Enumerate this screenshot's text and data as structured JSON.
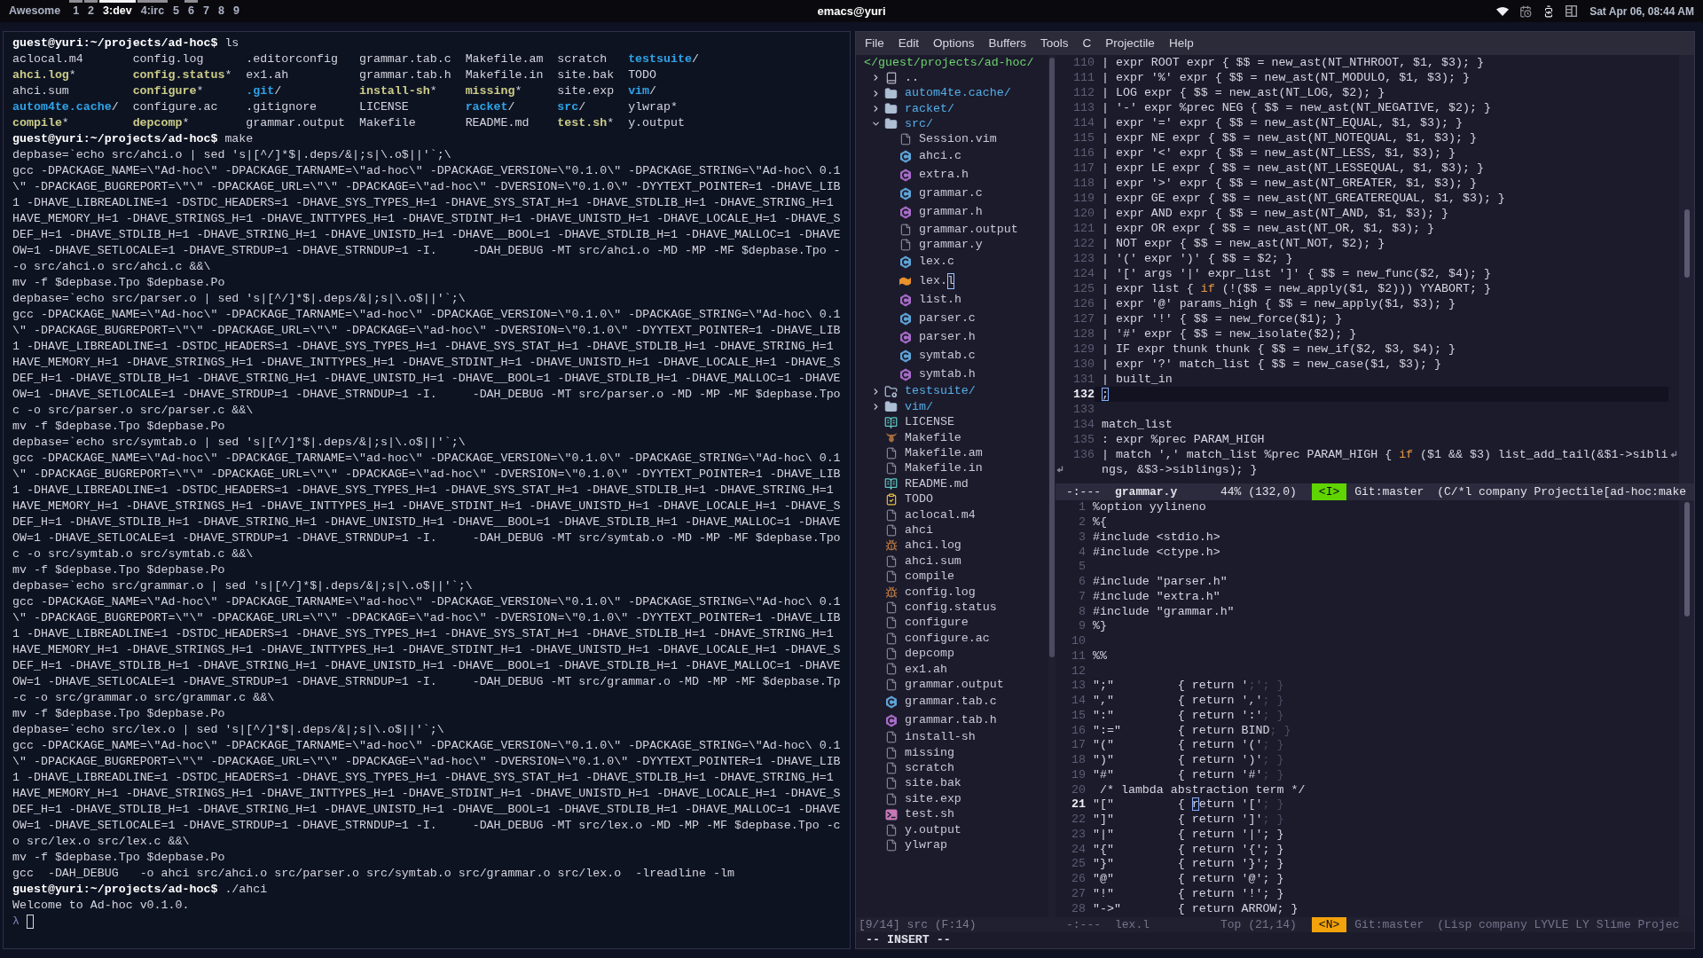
{
  "top_bar": {
    "launcher": "Awesome",
    "tags": [
      {
        "label": "1",
        "selected": false,
        "occupied": true
      },
      {
        "label": "2",
        "selected": false,
        "occupied": true
      },
      {
        "label": "3:dev",
        "selected": true,
        "occupied": true
      },
      {
        "label": "4:irc",
        "selected": false,
        "occupied": true
      },
      {
        "label": "5",
        "selected": false,
        "occupied": false
      },
      {
        "label": "6",
        "selected": false,
        "occupied": true
      },
      {
        "label": "7",
        "selected": false,
        "occupied": false
      },
      {
        "label": "8",
        "selected": false,
        "occupied": false
      },
      {
        "label": "9",
        "selected": false,
        "occupied": false
      }
    ],
    "title": "emacs@yuri",
    "clock": "Sat Apr 06, 08:44 AM"
  },
  "terminal": {
    "lines": [
      {
        "kind": "command",
        "prompt": "guest@yuri:~/projects/ad-hoc$",
        "command": "ls"
      },
      {
        "kind": "listing",
        "entries": [
          {
            "name": "aclocal.m4",
            "kind": "file"
          },
          {
            "name": "config.log",
            "kind": "file"
          },
          {
            "name": ".editorconfig",
            "kind": "file"
          },
          {
            "name": "grammar.tab.c",
            "kind": "file"
          },
          {
            "name": "Makefile.am",
            "kind": "file"
          },
          {
            "name": "scratch",
            "kind": "file"
          },
          {
            "name": "testsuite",
            "suffix": "/",
            "kind": "dir"
          }
        ]
      },
      {
        "kind": "listing",
        "entries": [
          {
            "name": "ahci.log",
            "suffix": "*",
            "kind": "exec"
          },
          {
            "name": "config.status",
            "suffix": "*",
            "kind": "exec"
          },
          {
            "name": "ex1.ah",
            "kind": "file"
          },
          {
            "name": "grammar.tab.h",
            "kind": "file"
          },
          {
            "name": "Makefile.in",
            "kind": "file"
          },
          {
            "name": "site.bak",
            "kind": "file"
          },
          {
            "name": "TODO",
            "kind": "file"
          }
        ]
      },
      {
        "kind": "listing",
        "entries": [
          {
            "name": "ahci.sum",
            "kind": "file"
          },
          {
            "name": "configure",
            "suffix": "*",
            "kind": "exec"
          },
          {
            "name": ".git",
            "suffix": "/",
            "kind": "dir"
          },
          {
            "name": "install-sh",
            "suffix": "*",
            "kind": "exec"
          },
          {
            "name": "missing",
            "suffix": "*",
            "kind": "exec"
          },
          {
            "name": "site.exp",
            "kind": "file"
          },
          {
            "name": "vim",
            "suffix": "/",
            "kind": "dir"
          }
        ]
      },
      {
        "kind": "listing",
        "entries": [
          {
            "name": "autom4te.cache",
            "suffix": "/",
            "kind": "dir"
          },
          {
            "name": "configure.ac",
            "kind": "file"
          },
          {
            "name": ".gitignore",
            "kind": "file"
          },
          {
            "name": "LICENSE",
            "kind": "file"
          },
          {
            "name": "racket",
            "suffix": "/",
            "kind": "dir"
          },
          {
            "name": "src",
            "suffix": "/",
            "kind": "dir"
          },
          {
            "name": "ylwrap",
            "suffix": "*",
            "kind": "file"
          }
        ]
      },
      {
        "kind": "listing",
        "entries": [
          {
            "name": "compile",
            "suffix": "*",
            "kind": "exec"
          },
          {
            "name": "depcomp",
            "suffix": "*",
            "kind": "exec"
          },
          {
            "name": "grammar.output",
            "kind": "file"
          },
          {
            "name": "Makefile",
            "kind": "file"
          },
          {
            "name": "README.md",
            "kind": "file"
          },
          {
            "name": "test.sh",
            "suffix": "*",
            "kind": "exec"
          },
          {
            "name": "y.output",
            "kind": "file"
          }
        ]
      },
      {
        "kind": "command",
        "prompt": "guest@yuri:~/projects/ad-hoc$",
        "command": "make"
      },
      {
        "kind": "output",
        "text": "depbase=`echo src/ahci.o | sed 's|[^/]*$|.deps/&|;s|\\.o$||'`;\\"
      },
      {
        "kind": "output",
        "text": "gcc -DPACKAGE_NAME=\\\"Ad-hoc\\\" -DPACKAGE_TARNAME=\\\"ad-hoc\\\" -DPACKAGE_VERSION=\\\"0.1.0\\\" -DPACKAGE_STRING=\\\"Ad-hoc\\ 0.1"
      },
      {
        "kind": "output",
        "text": "\\\" -DPACKAGE_BUGREPORT=\\\"\\\" -DPACKAGE_URL=\\\"\\\" -DPACKAGE=\\\"ad-hoc\\\" -DVERSION=\\\"0.1.0\\\" -DYYTEXT_POINTER=1 -DHAVE_LIB"
      },
      {
        "kind": "output",
        "text": "1 -DHAVE_LIBREADLINE=1 -DSTDC_HEADERS=1 -DHAVE_SYS_TYPES_H=1 -DHAVE_SYS_STAT_H=1 -DHAVE_STDLIB_H=1 -DHAVE_STRING_H=1"
      },
      {
        "kind": "output",
        "text": "HAVE_MEMORY_H=1 -DHAVE_STRINGS_H=1 -DHAVE_INTTYPES_H=1 -DHAVE_STDINT_H=1 -DHAVE_UNISTD_H=1 -DHAVE_LOCALE_H=1 -DHAVE_S"
      },
      {
        "kind": "output",
        "text": "DEF_H=1 -DHAVE_STDLIB_H=1 -DHAVE_STRING_H=1 -DHAVE_UNISTD_H=1 -DHAVE__BOOL=1 -DHAVE_STDLIB_H=1 -DHAVE_MALLOC=1 -DHAVE"
      },
      {
        "kind": "output",
        "text": "OW=1 -DHAVE_SETLOCALE=1 -DHAVE_STRDUP=1 -DHAVE_STRNDUP=1 -I.     -DAH_DEBUG -MT src/ahci.o -MD -MP -MF $depbase.Tpo -"
      },
      {
        "kind": "output",
        "text": "-o src/ahci.o src/ahci.c &&\\"
      },
      {
        "kind": "output",
        "text": "mv -f $depbase.Tpo $depbase.Po"
      },
      {
        "kind": "output",
        "text": "depbase=`echo src/parser.o | sed 's|[^/]*$|.deps/&|;s|\\.o$||'`;\\"
      },
      {
        "kind": "output",
        "text": "gcc -DPACKAGE_NAME=\\\"Ad-hoc\\\" -DPACKAGE_TARNAME=\\\"ad-hoc\\\" -DPACKAGE_VERSION=\\\"0.1.0\\\" -DPACKAGE_STRING=\\\"Ad-hoc\\ 0.1"
      },
      {
        "kind": "output",
        "text": "\\\" -DPACKAGE_BUGREPORT=\\\"\\\" -DPACKAGE_URL=\\\"\\\" -DPACKAGE=\\\"ad-hoc\\\" -DVERSION=\\\"0.1.0\\\" -DYYTEXT_POINTER=1 -DHAVE_LIB"
      },
      {
        "kind": "output",
        "text": "1 -DHAVE_LIBREADLINE=1 -DSTDC_HEADERS=1 -DHAVE_SYS_TYPES_H=1 -DHAVE_SYS_STAT_H=1 -DHAVE_STDLIB_H=1 -DHAVE_STRING_H=1"
      },
      {
        "kind": "output",
        "text": "HAVE_MEMORY_H=1 -DHAVE_STRINGS_H=1 -DHAVE_INTTYPES_H=1 -DHAVE_STDINT_H=1 -DHAVE_UNISTD_H=1 -DHAVE_LOCALE_H=1 -DHAVE_S"
      },
      {
        "kind": "output",
        "text": "DEF_H=1 -DHAVE_STDLIB_H=1 -DHAVE_STRING_H=1 -DHAVE_UNISTD_H=1 -DHAVE__BOOL=1 -DHAVE_STDLIB_H=1 -DHAVE_MALLOC=1 -DHAVE"
      },
      {
        "kind": "output",
        "text": "OW=1 -DHAVE_SETLOCALE=1 -DHAVE_STRDUP=1 -DHAVE_STRNDUP=1 -I.     -DAH_DEBUG -MT src/parser.o -MD -MP -MF $depbase.Tpo"
      },
      {
        "kind": "output",
        "text": "c -o src/parser.o src/parser.c &&\\"
      },
      {
        "kind": "output",
        "text": "mv -f $depbase.Tpo $depbase.Po"
      },
      {
        "kind": "output",
        "text": "depbase=`echo src/symtab.o | sed 's|[^/]*$|.deps/&|;s|\\.o$||'`;\\"
      },
      {
        "kind": "output",
        "text": "gcc -DPACKAGE_NAME=\\\"Ad-hoc\\\" -DPACKAGE_TARNAME=\\\"ad-hoc\\\" -DPACKAGE_VERSION=\\\"0.1.0\\\" -DPACKAGE_STRING=\\\"Ad-hoc\\ 0.1"
      },
      {
        "kind": "output",
        "text": "\\\" -DPACKAGE_BUGREPORT=\\\"\\\" -DPACKAGE_URL=\\\"\\\" -DPACKAGE=\\\"ad-hoc\\\" -DVERSION=\\\"0.1.0\\\" -DYYTEXT_POINTER=1 -DHAVE_LIB"
      },
      {
        "kind": "output",
        "text": "1 -DHAVE_LIBREADLINE=1 -DSTDC_HEADERS=1 -DHAVE_SYS_TYPES_H=1 -DHAVE_SYS_STAT_H=1 -DHAVE_STDLIB_H=1 -DHAVE_STRING_H=1"
      },
      {
        "kind": "output",
        "text": "HAVE_MEMORY_H=1 -DHAVE_STRINGS_H=1 -DHAVE_INTTYPES_H=1 -DHAVE_STDINT_H=1 -DHAVE_UNISTD_H=1 -DHAVE_LOCALE_H=1 -DHAVE_S"
      },
      {
        "kind": "output",
        "text": "DEF_H=1 -DHAVE_STDLIB_H=1 -DHAVE_STRING_H=1 -DHAVE_UNISTD_H=1 -DHAVE__BOOL=1 -DHAVE_STDLIB_H=1 -DHAVE_MALLOC=1 -DHAVE"
      },
      {
        "kind": "output",
        "text": "OW=1 -DHAVE_SETLOCALE=1 -DHAVE_STRDUP=1 -DHAVE_STRNDUP=1 -I.     -DAH_DEBUG -MT src/symtab.o -MD -MP -MF $depbase.Tpo"
      },
      {
        "kind": "output",
        "text": "c -o src/symtab.o src/symtab.c &&\\"
      },
      {
        "kind": "output",
        "text": "mv -f $depbase.Tpo $depbase.Po"
      },
      {
        "kind": "output",
        "text": "depbase=`echo src/grammar.o | sed 's|[^/]*$|.deps/&|;s|\\.o$||'`;\\"
      },
      {
        "kind": "output",
        "text": "gcc -DPACKAGE_NAME=\\\"Ad-hoc\\\" -DPACKAGE_TARNAME=\\\"ad-hoc\\\" -DPACKAGE_VERSION=\\\"0.1.0\\\" -DPACKAGE_STRING=\\\"Ad-hoc\\ 0.1"
      },
      {
        "kind": "output",
        "text": "\\\" -DPACKAGE_BUGREPORT=\\\"\\\" -DPACKAGE_URL=\\\"\\\" -DPACKAGE=\\\"ad-hoc\\\" -DVERSION=\\\"0.1.0\\\" -DYYTEXT_POINTER=1 -DHAVE_LIB"
      },
      {
        "kind": "output",
        "text": "1 -DHAVE_LIBREADLINE=1 -DSTDC_HEADERS=1 -DHAVE_SYS_TYPES_H=1 -DHAVE_SYS_STAT_H=1 -DHAVE_STDLIB_H=1 -DHAVE_STRING_H=1"
      },
      {
        "kind": "output",
        "text": "HAVE_MEMORY_H=1 -DHAVE_STRINGS_H=1 -DHAVE_INTTYPES_H=1 -DHAVE_STDINT_H=1 -DHAVE_UNISTD_H=1 -DHAVE_LOCALE_H=1 -DHAVE_S"
      },
      {
        "kind": "output",
        "text": "DEF_H=1 -DHAVE_STDLIB_H=1 -DHAVE_STRING_H=1 -DHAVE_UNISTD_H=1 -DHAVE__BOOL=1 -DHAVE_STDLIB_H=1 -DHAVE_MALLOC=1 -DHAVE"
      },
      {
        "kind": "output",
        "text": "OW=1 -DHAVE_SETLOCALE=1 -DHAVE_STRDUP=1 -DHAVE_STRNDUP=1 -I.     -DAH_DEBUG -MT src/grammar.o -MD -MP -MF $depbase.Tp"
      },
      {
        "kind": "output",
        "text": "-c -o src/grammar.o src/grammar.c &&\\"
      },
      {
        "kind": "output",
        "text": "mv -f $depbase.Tpo $depbase.Po"
      },
      {
        "kind": "output",
        "text": "depbase=`echo src/lex.o | sed 's|[^/]*$|.deps/&|;s|\\.o$||'`;\\"
      },
      {
        "kind": "output",
        "text": "gcc -DPACKAGE_NAME=\\\"Ad-hoc\\\" -DPACKAGE_TARNAME=\\\"ad-hoc\\\" -DPACKAGE_VERSION=\\\"0.1.0\\\" -DPACKAGE_STRING=\\\"Ad-hoc\\ 0.1"
      },
      {
        "kind": "output",
        "text": "\\\" -DPACKAGE_BUGREPORT=\\\"\\\" -DPACKAGE_URL=\\\"\\\" -DPACKAGE=\\\"ad-hoc\\\" -DVERSION=\\\"0.1.0\\\" -DYYTEXT_POINTER=1 -DHAVE_LIB"
      },
      {
        "kind": "output",
        "text": "1 -DHAVE_LIBREADLINE=1 -DSTDC_HEADERS=1 -DHAVE_SYS_TYPES_H=1 -DHAVE_SYS_STAT_H=1 -DHAVE_STDLIB_H=1 -DHAVE_STRING_H=1"
      },
      {
        "kind": "output",
        "text": "HAVE_MEMORY_H=1 -DHAVE_STRINGS_H=1 -DHAVE_INTTYPES_H=1 -DHAVE_STDINT_H=1 -DHAVE_UNISTD_H=1 -DHAVE_LOCALE_H=1 -DHAVE_S"
      },
      {
        "kind": "output",
        "text": "DEF_H=1 -DHAVE_STDLIB_H=1 -DHAVE_STRING_H=1 -DHAVE_UNISTD_H=1 -DHAVE__BOOL=1 -DHAVE_STDLIB_H=1 -DHAVE_MALLOC=1 -DHAVE"
      },
      {
        "kind": "output",
        "text": "OW=1 -DHAVE_SETLOCALE=1 -DHAVE_STRDUP=1 -DHAVE_STRNDUP=1 -I.     -DAH_DEBUG -MT src/lex.o -MD -MP -MF $depbase.Tpo -c"
      },
      {
        "kind": "output",
        "text": "o src/lex.o src/lex.c &&\\"
      },
      {
        "kind": "output",
        "text": "mv -f $depbase.Tpo $depbase.Po"
      },
      {
        "kind": "output",
        "text": "gcc  -DAH_DEBUG   -o ahci src/ahci.o src/parser.o src/symtab.o src/grammar.o src/lex.o  -lreadline -lm"
      },
      {
        "kind": "command",
        "prompt": "guest@yuri:~/projects/ad-hoc$",
        "command": "./ahci"
      },
      {
        "kind": "output",
        "text": "Welcome to Ad-hoc v0.1.0."
      },
      {
        "kind": "input",
        "prompt": "λ"
      }
    ]
  },
  "emacs": {
    "menu": [
      "File",
      "Edit",
      "Options",
      "Buffers",
      "Tools",
      "C",
      "Projectile",
      "Help"
    ],
    "tree": {
      "header": "</guest/projects/ad-hoc/",
      "items": [
        {
          "name": "..",
          "kind": "parent",
          "expanded": false,
          "selected": false
        },
        {
          "name": "autom4te.cache/",
          "kind": "dir",
          "expanded": false,
          "selected": false
        },
        {
          "name": "racket/",
          "kind": "dir",
          "expanded": false,
          "selected": false
        },
        {
          "name": "src/",
          "kind": "dir",
          "expanded": true,
          "selected": false,
          "children": [
            {
              "name": "Session.vim",
              "kind": "file",
              "selected": false
            },
            {
              "name": "ahci.c",
              "kind": "c",
              "selected": false
            },
            {
              "name": "extra.h",
              "kind": "h",
              "selected": false
            },
            {
              "name": "grammar.c",
              "kind": "c",
              "selected": false
            },
            {
              "name": "grammar.h",
              "kind": "h",
              "selected": false
            },
            {
              "name": "grammar.output",
              "kind": "file",
              "selected": false
            },
            {
              "name": "grammar.y",
              "kind": "file",
              "selected": false
            },
            {
              "name": "lex.c",
              "kind": "c",
              "selected": false
            },
            {
              "name": "lex.l",
              "kind": "lex",
              "selected": true
            },
            {
              "name": "list.h",
              "kind": "h",
              "selected": false
            },
            {
              "name": "parser.c",
              "kind": "c",
              "selected": false
            },
            {
              "name": "parser.h",
              "kind": "h",
              "selected": false
            },
            {
              "name": "symtab.c",
              "kind": "c",
              "selected": false
            },
            {
              "name": "symtab.h",
              "kind": "h",
              "selected": false
            }
          ]
        },
        {
          "name": "testsuite/",
          "kind": "test-dir",
          "expanded": false,
          "selected": false
        },
        {
          "name": "vim/",
          "kind": "dir",
          "expanded": false,
          "selected": false
        },
        {
          "name": "LICENSE",
          "kind": "book",
          "selected": false
        },
        {
          "name": "Makefile",
          "kind": "gnu",
          "selected": false
        },
        {
          "name": "Makefile.am",
          "kind": "file",
          "selected": false
        },
        {
          "name": "Makefile.in",
          "kind": "file",
          "selected": false
        },
        {
          "name": "README.md",
          "kind": "book",
          "selected": false
        },
        {
          "name": "TODO",
          "kind": "todo",
          "selected": false
        },
        {
          "name": "aclocal.m4",
          "kind": "file",
          "selected": false
        },
        {
          "name": "ahci",
          "kind": "file",
          "selected": false
        },
        {
          "name": "ahci.log",
          "kind": "bug",
          "selected": false
        },
        {
          "name": "ahci.sum",
          "kind": "file",
          "selected": false
        },
        {
          "name": "compile",
          "kind": "file",
          "selected": false
        },
        {
          "name": "config.log",
          "kind": "bug",
          "selected": false
        },
        {
          "name": "config.status",
          "kind": "file",
          "selected": false
        },
        {
          "name": "configure",
          "kind": "file",
          "selected": false
        },
        {
          "name": "configure.ac",
          "kind": "file",
          "selected": false
        },
        {
          "name": "depcomp",
          "kind": "file",
          "selected": false
        },
        {
          "name": "ex1.ah",
          "kind": "file",
          "selected": false
        },
        {
          "name": "grammar.output",
          "kind": "file",
          "selected": false
        },
        {
          "name": "grammar.tab.c",
          "kind": "c",
          "selected": false
        },
        {
          "name": "grammar.tab.h",
          "kind": "h",
          "selected": false
        },
        {
          "name": "install-sh",
          "kind": "file",
          "selected": false
        },
        {
          "name": "missing",
          "kind": "file",
          "selected": false
        },
        {
          "name": "scratch",
          "kind": "file",
          "selected": false
        },
        {
          "name": "site.bak",
          "kind": "file",
          "selected": false
        },
        {
          "name": "site.exp",
          "kind": "file",
          "selected": false
        },
        {
          "name": "test.sh",
          "kind": "shell",
          "selected": false
        },
        {
          "name": "y.output",
          "kind": "file",
          "selected": false
        },
        {
          "name": "ylwrap",
          "kind": "file",
          "selected": false
        }
      ],
      "status": "[9/14] src (F:14)"
    },
    "windows": [
      {
        "lines": [
          {
            "number": "110",
            "text": "| expr ROOT expr { $$ = new_ast(NT_NTHROOT, $1, $3); }",
            "current": false
          },
          {
            "number": "111",
            "text": "| expr '%' expr { $$ = new_ast(NT_MODULO, $1, $3); }",
            "current": false
          },
          {
            "number": "112",
            "text": "| LOG expr { $$ = new_ast(NT_LOG, $2); }",
            "current": false
          },
          {
            "number": "113",
            "text": "| '-' expr %prec NEG { $$ = new_ast(NT_NEGATIVE, $2); }",
            "current": false
          },
          {
            "number": "114",
            "text": "| expr '=' expr { $$ = new_ast(NT_EQUAL, $1, $3); }",
            "current": false
          },
          {
            "number": "115",
            "text": "| expr NE expr { $$ = new_ast(NT_NOTEQUAL, $1, $3); }",
            "current": false
          },
          {
            "number": "116",
            "text": "| expr '<' expr { $$ = new_ast(NT_LESS, $1, $3); }",
            "current": false
          },
          {
            "number": "117",
            "text": "| expr LE expr { $$ = new_ast(NT_LESSEQUAL, $1, $3); }",
            "current": false
          },
          {
            "number": "118",
            "text": "| expr '>' expr { $$ = new_ast(NT_GREATER, $1, $3); }",
            "current": false
          },
          {
            "number": "119",
            "text": "| expr GE expr { $$ = new_ast(NT_GREATEREQUAL, $1, $3); }",
            "current": false
          },
          {
            "number": "120",
            "text": "| expr AND expr { $$ = new_ast(NT_AND, $1, $3); }",
            "current": false
          },
          {
            "number": "121",
            "text": "| expr OR expr { $$ = new_ast(NT_OR, $1, $3); }",
            "current": false
          },
          {
            "number": "122",
            "text": "| NOT expr { $$ = new_ast(NT_NOT, $2); }",
            "current": false
          },
          {
            "number": "123",
            "text": "| '(' expr ')' { $$ = $2; }",
            "current": false
          },
          {
            "number": "124",
            "text": "| '[' args '|' expr_list ']' { $$ = new_func($2, $4); }",
            "current": false
          },
          {
            "number": "125",
            "segments": [
              {
                "text": "| expr list { ",
                "kind": "plain"
              },
              {
                "text": "if",
                "kind": "keyword"
              },
              {
                "text": " (!($$ = new_apply($1, $2))) YYABORT; }",
                "kind": "plain"
              }
            ],
            "current": false
          },
          {
            "number": "126",
            "text": "| expr '@' params_high { $$ = new_apply($1, $3); }",
            "current": false
          },
          {
            "number": "127",
            "text": "| expr '!' { $$ = new_force($1); }",
            "current": false
          },
          {
            "number": "128",
            "text": "| '#' expr { $$ = new_isolate($2); }",
            "current": false
          },
          {
            "number": "129",
            "text": "| IF expr thunk thunk { $$ = new_if($2, $3, $4); }",
            "current": false
          },
          {
            "number": "130",
            "text": "| expr '?' match_list { $$ = new_case($1, $3); }",
            "current": false
          },
          {
            "number": "131",
            "text": "| built_in",
            "current": false
          },
          {
            "number": "132",
            "segments": [
              {
                "text": ";",
                "kind": "cursor"
              }
            ],
            "current": true
          },
          {
            "number": "133",
            "current": false
          },
          {
            "number": "134",
            "text": "match_list",
            "current": false
          },
          {
            "number": "135",
            "text": ": expr %prec PARAM_HIGH",
            "current": false
          },
          {
            "number": "136",
            "segments": [
              {
                "text": "| match ',' match_list %prec PARAM_HIGH { ",
                "kind": "plain"
              },
              {
                "text": "if",
                "kind": "keyword"
              },
              {
                "text": " ($1 && $3) list_add_tail(&$1->sibli",
                "kind": "plain"
              }
            ],
            "continuation": "ngs, &$3->siblings); }",
            "current": false
          }
        ],
        "mode_line": {
          "status": "-:---",
          "buffer": "grammar.y",
          "position": "44% (132,0)",
          "state": {
            "label": "<I>",
            "kind": "insert"
          },
          "vc": "Git:master",
          "modes": "(C/*l company Projectile[ad-hoc:make",
          "active": true
        }
      },
      {
        "lines": [
          {
            "number": "1",
            "text": "%option yylineno",
            "current": false
          },
          {
            "number": "2",
            "text": "%{",
            "current": false
          },
          {
            "number": "3",
            "text": "#include <stdio.h>",
            "current": false
          },
          {
            "number": "4",
            "text": "#include <ctype.h>",
            "current": false
          },
          {
            "number": "5",
            "current": false
          },
          {
            "number": "6",
            "text": "#include \"parser.h\"",
            "current": false
          },
          {
            "number": "7",
            "text": "#include \"extra.h\"",
            "current": false
          },
          {
            "number": "8",
            "text": "#include \"grammar.h\"",
            "current": false
          },
          {
            "number": "9",
            "text": "%}",
            "current": false
          },
          {
            "number": "10",
            "current": false
          },
          {
            "number": "11",
            "text": "%%",
            "current": false
          },
          {
            "number": "12",
            "current": false
          },
          {
            "number": "13",
            "segments": [
              {
                "text": "\";\"         { return '",
                "kind": "plain"
              },
              {
                "text": ";'; }",
                "kind": "dim"
              }
            ],
            "current": false
          },
          {
            "number": "14",
            "segments": [
              {
                "text": "\",\"         { return ','",
                "kind": "plain"
              },
              {
                "text": "; }",
                "kind": "dim"
              }
            ],
            "current": false
          },
          {
            "number": "15",
            "segments": [
              {
                "text": "\":\"         { return ':'",
                "kind": "plain"
              },
              {
                "text": "; }",
                "kind": "dim"
              }
            ],
            "current": false
          },
          {
            "number": "16",
            "segments": [
              {
                "text": "\":=\"        { return BIND",
                "kind": "plain"
              },
              {
                "text": "; }",
                "kind": "dim"
              }
            ],
            "current": false
          },
          {
            "number": "17",
            "segments": [
              {
                "text": "\"(\"         { return '('",
                "kind": "plain"
              },
              {
                "text": "; }",
                "kind": "dim"
              }
            ],
            "current": false
          },
          {
            "number": "18",
            "segments": [
              {
                "text": "\")\"         { return ')'",
                "kind": "plain"
              },
              {
                "text": "; }",
                "kind": "dim"
              }
            ],
            "current": false
          },
          {
            "number": "19",
            "segments": [
              {
                "text": "\"#\"         { return '#'",
                "kind": "plain"
              },
              {
                "text": "; }",
                "kind": "dim"
              }
            ],
            "current": false
          },
          {
            "number": "20",
            "text": " /* lambda abstraction term */",
            "current": false
          },
          {
            "number": "21",
            "segments": [
              {
                "text": "\"[\"         { ",
                "kind": "plain"
              },
              {
                "text": "r",
                "kind": "cursor"
              },
              {
                "text": "eturn '['",
                "kind": "plain"
              },
              {
                "text": "; }",
                "kind": "dim"
              }
            ],
            "current": true
          },
          {
            "number": "22",
            "segments": [
              {
                "text": "\"]\"         { return ']'",
                "kind": "plain"
              },
              {
                "text": "; }",
                "kind": "dim"
              }
            ],
            "current": false
          },
          {
            "number": "23",
            "text": "\"|\"         { return '|'; }",
            "current": false
          },
          {
            "number": "24",
            "text": "\"{\"         { return '{'; }",
            "current": false
          },
          {
            "number": "25",
            "text": "\"}\"         { return '}'; }",
            "current": false
          },
          {
            "number": "26",
            "text": "\"@\"         { return '@'; }",
            "current": false
          },
          {
            "number": "27",
            "text": "\"!\"         { return '!'; }",
            "current": false
          },
          {
            "number": "28",
            "text": "\"->\"        { return ARROW; }",
            "current": false
          }
        ],
        "mode_line": {
          "status": "-:---",
          "buffer": "lex.l",
          "position": "Top (21,14)",
          "state": {
            "label": "<N>",
            "kind": "normal"
          },
          "vc": "Git:master",
          "modes": "(Lisp company LYVLE LY Slime Projec",
          "active": false
        }
      }
    ],
    "echo": "-- INSERT --"
  }
}
